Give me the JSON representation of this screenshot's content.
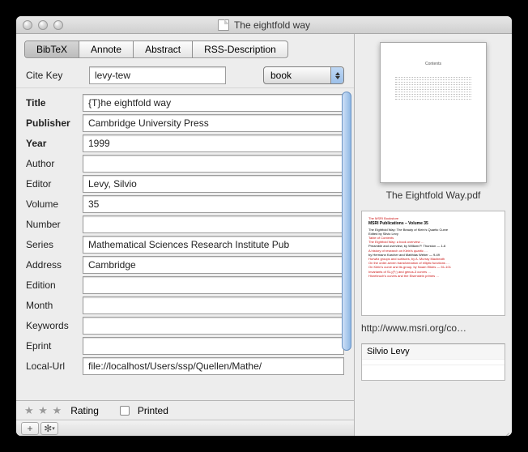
{
  "window": {
    "title": "The eightfold way"
  },
  "tabs": [
    "BibTeX",
    "Annote",
    "Abstract",
    "RSS-Description"
  ],
  "active_tab": 0,
  "citekey": {
    "label": "Cite Key",
    "value": "levy-tew"
  },
  "type_select": {
    "value": "book"
  },
  "fields": [
    {
      "label": "Title",
      "value": "{T}he eightfold way",
      "bold": true
    },
    {
      "label": "Publisher",
      "value": "Cambridge University Press",
      "bold": true
    },
    {
      "label": "Year",
      "value": "1999",
      "bold": true
    },
    {
      "label": "Author",
      "value": ""
    },
    {
      "label": "Editor",
      "value": "Levy, Silvio"
    },
    {
      "label": "Volume",
      "value": "35"
    },
    {
      "label": "Number",
      "value": ""
    },
    {
      "label": "Series",
      "value": "Mathematical Sciences Research Institute Pub"
    },
    {
      "label": "Address",
      "value": "Cambridge"
    },
    {
      "label": "Edition",
      "value": ""
    },
    {
      "label": "Month",
      "value": ""
    },
    {
      "label": "Keywords",
      "value": ""
    },
    {
      "label": "Eprint",
      "value": ""
    },
    {
      "label": "Local-Url",
      "value": "file://localhost/Users/ssp/Quellen/Mathe/"
    }
  ],
  "footer": {
    "rating_label": "Rating",
    "printed_label": "Printed"
  },
  "preview": {
    "pdf_label": "The Eightfold Way.pdf",
    "web_url": "http://www.msri.org/co…",
    "web_heading": "MSRI Publications – Volume 35",
    "web_sub": "The Eightfold Way: The Beauty of Klein's Quartic Curve",
    "web_ed": "Edited by Silvio Levy"
  },
  "people": [
    "Silvio Levy"
  ]
}
